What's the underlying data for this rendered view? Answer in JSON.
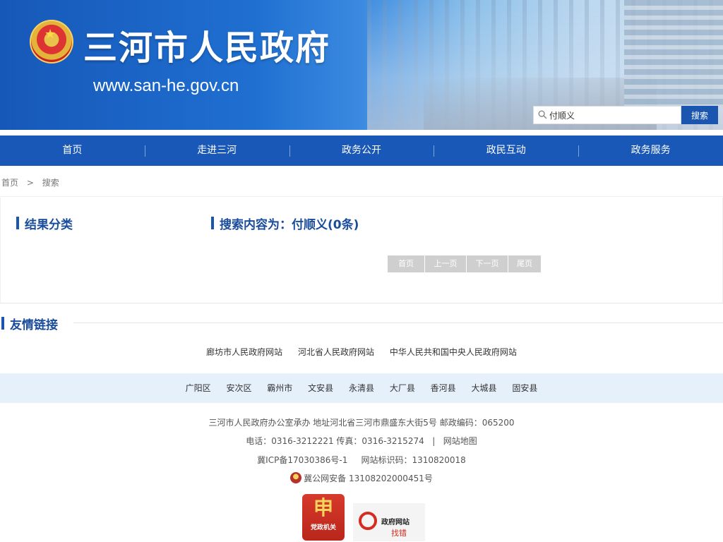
{
  "header": {
    "site_title": "三河市人民政府",
    "site_url": "www.san-he.gov.cn",
    "search": {
      "value": "付顺义",
      "button_label": "搜索"
    }
  },
  "nav": {
    "items": [
      "首页",
      "走进三河",
      "政务公开",
      "政民互动",
      "政务服务"
    ]
  },
  "breadcrumb": {
    "home": "首页",
    "sep": ">",
    "current": "搜索"
  },
  "results": {
    "category_title": "结果分类",
    "result_title": "搜索内容为：付顺义(0条)",
    "pager": {
      "first": "首页",
      "prev": "上一页",
      "next": "下一页",
      "last": "尾页"
    }
  },
  "links": {
    "title": "友情链接",
    "sites": [
      "廊坊市人民政府网站",
      "河北省人民政府网站",
      "中华人民共和国中央人民政府网站"
    ],
    "counties": [
      "广阳区",
      "安次区",
      "霸州市",
      "文安县",
      "永清县",
      "大厂县",
      "香河县",
      "大城县",
      "固安县"
    ]
  },
  "footer": {
    "line1": "三河市人民政府办公室承办 地址河北省三河市鼎盛东大街5号 邮政编码：065200",
    "phone": "电话：0316-3212221 传真：0316-3215274",
    "sep": "|",
    "sitemap": "网站地图",
    "icp": "冀ICP备17030386号-1",
    "site_code": "网站标识码：1310820018",
    "police": "冀公网安备 13108202000451号",
    "badge_red_glyph": "申",
    "badge_red_text": "党政机关",
    "badge_find_title": "政府网站",
    "badge_find_sub": "找错"
  },
  "colors": {
    "primary": "#1a58b8",
    "title": "#1a4c9c",
    "county_bg": "#e6f0fb"
  }
}
